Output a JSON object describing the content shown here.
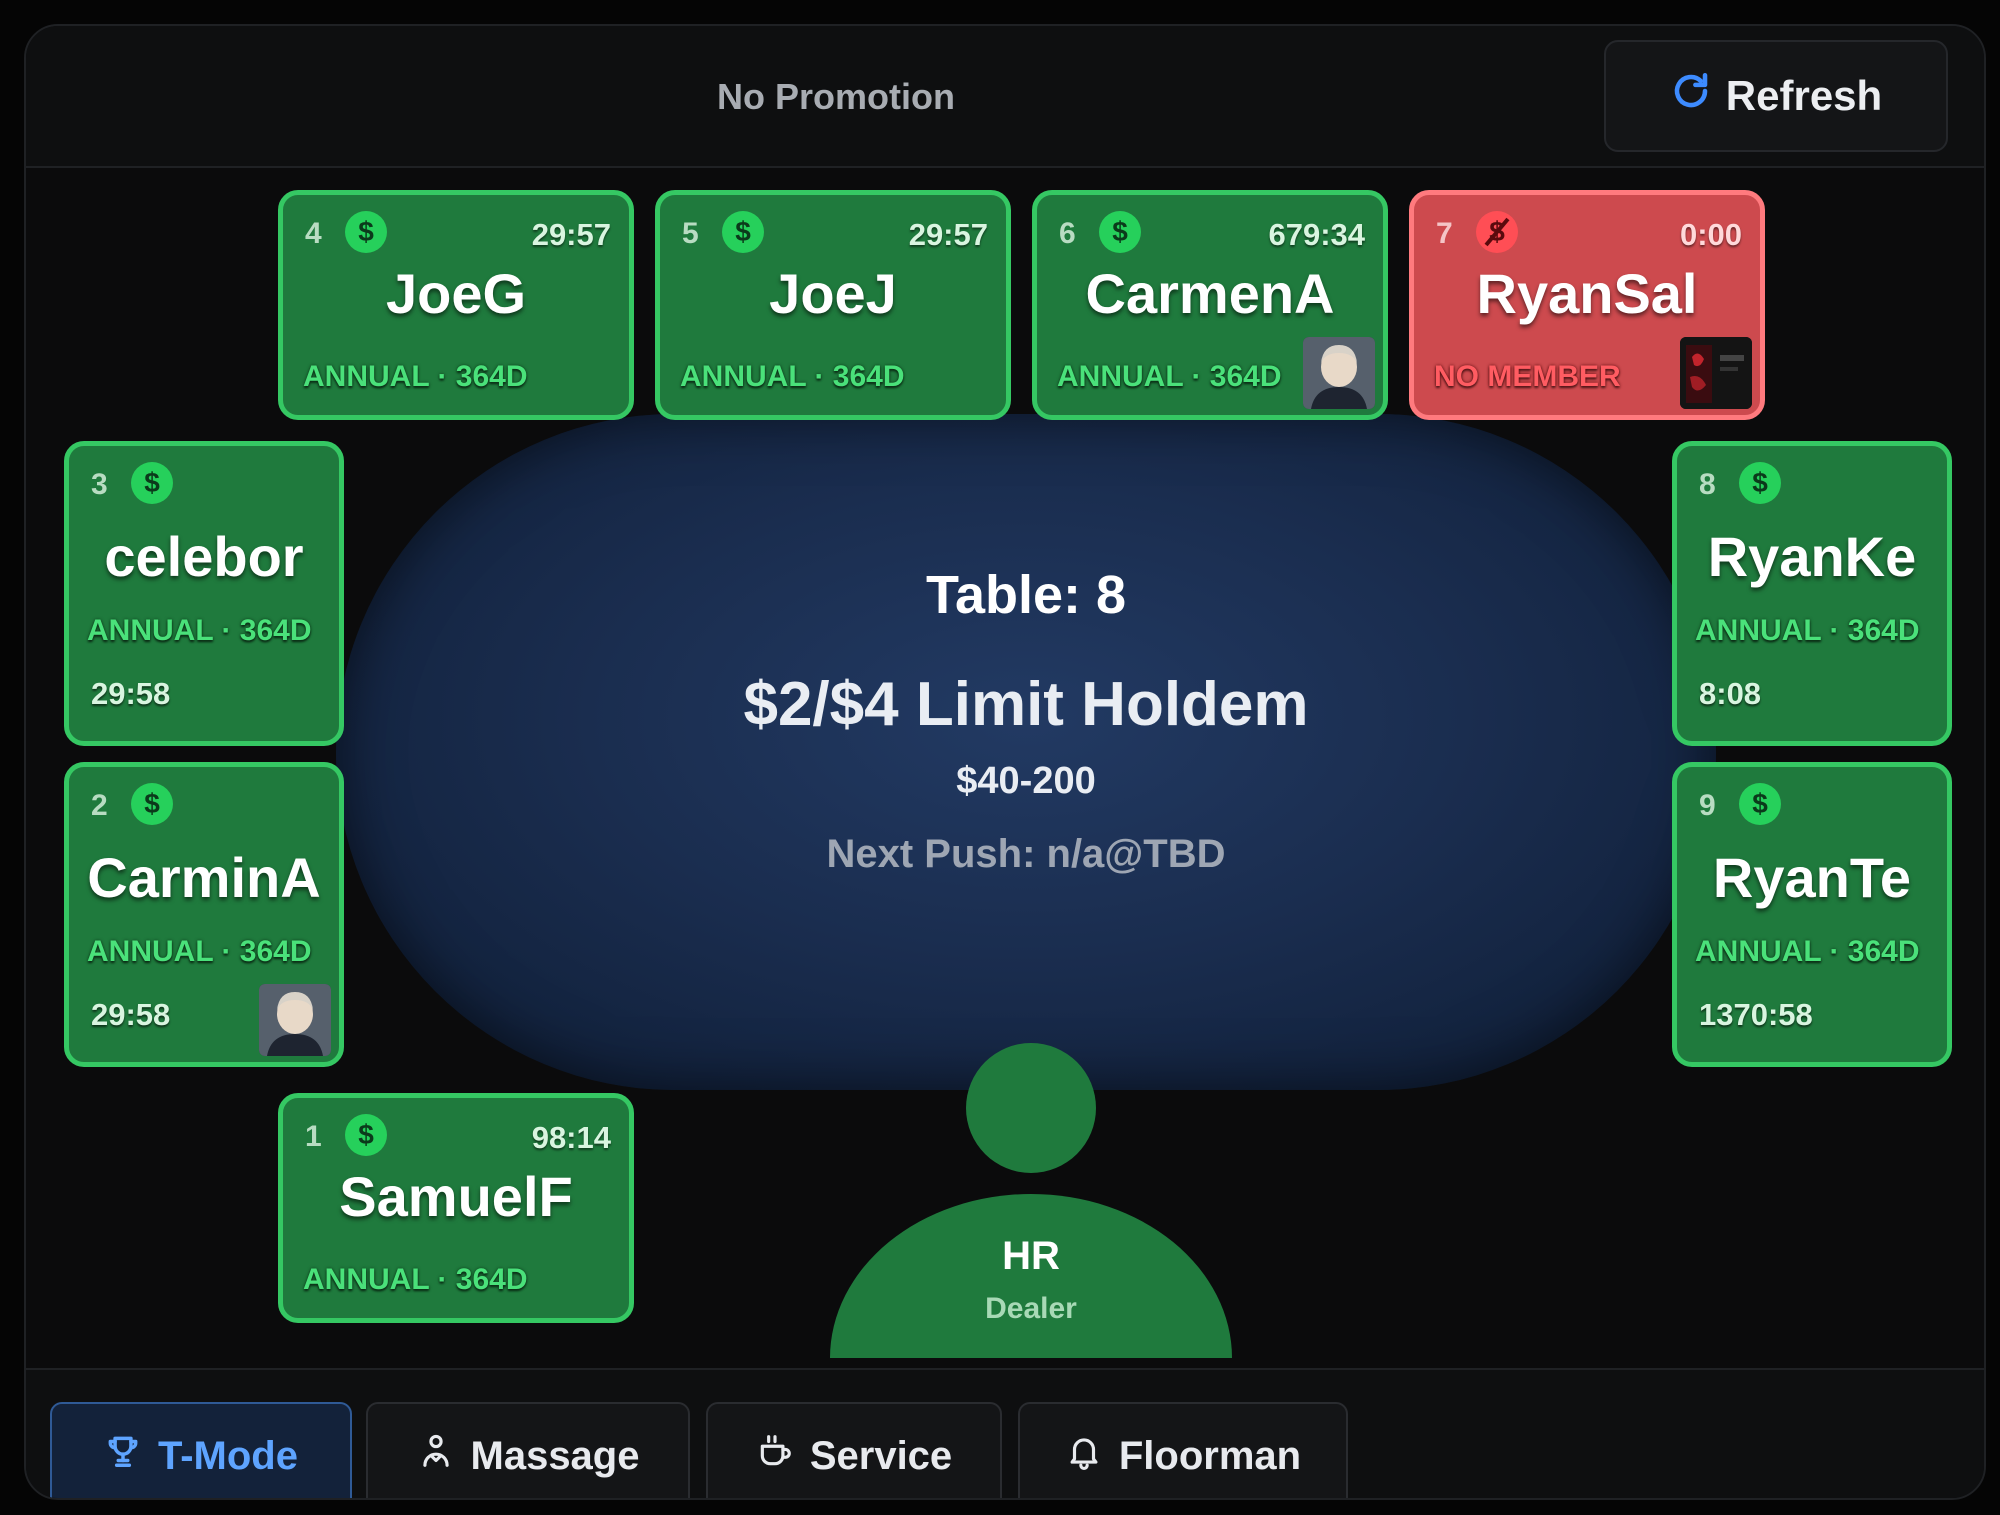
{
  "header": {
    "promotion": "No Promotion",
    "refresh_label": "Refresh"
  },
  "table": {
    "title": "Table: 8",
    "game": "$2/$4 Limit Holdem",
    "buyin": "$40-200",
    "next_push": "Next Push: n/a@TBD"
  },
  "seats": {
    "s1": {
      "num": "1",
      "name": "SamuelF",
      "membership": "ANNUAL · 364D",
      "time": "98:14",
      "paid": true
    },
    "s2": {
      "num": "2",
      "name": "CarminA",
      "membership": "ANNUAL · 364D",
      "time": "29:58",
      "paid": true,
      "avatar": "photo"
    },
    "s3": {
      "num": "3",
      "name": "celebor",
      "membership": "ANNUAL · 364D",
      "time": "29:58",
      "paid": true
    },
    "s4": {
      "num": "4",
      "name": "JoeG",
      "membership": "ANNUAL · 364D",
      "time": "29:57",
      "paid": true
    },
    "s5": {
      "num": "5",
      "name": "JoeJ",
      "membership": "ANNUAL · 364D",
      "time": "29:57",
      "paid": true
    },
    "s6": {
      "num": "6",
      "name": "CarmenA",
      "membership": "ANNUAL · 364D",
      "time": "679:34",
      "paid": true,
      "avatar": "photo"
    },
    "s7": {
      "num": "7",
      "name": "RyanSal",
      "membership": "NO MEMBER",
      "time": "0:00",
      "paid": false,
      "avatar": "photo"
    },
    "s8": {
      "num": "8",
      "name": "RyanKe",
      "membership": "ANNUAL · 364D",
      "time": "8:08",
      "paid": true
    },
    "s9": {
      "num": "9",
      "name": "RyanTe",
      "membership": "ANNUAL · 364D",
      "time": "1370:58",
      "paid": true
    }
  },
  "dealer": {
    "initials": "HR",
    "role": "Dealer"
  },
  "footer": {
    "buttons": [
      {
        "label": "T-Mode",
        "icon": "trophy-icon",
        "active": true
      },
      {
        "label": "Massage",
        "icon": "person-icon",
        "active": false
      },
      {
        "label": "Service",
        "icon": "cup-icon",
        "active": false
      },
      {
        "label": "Floorman",
        "icon": "bell-icon",
        "active": false
      }
    ]
  },
  "colors": {
    "seat_green": "#1f7a3d",
    "seat_green_border": "#35c863",
    "seat_red": "#cd4a4e",
    "accent_blue": "#5ea4ff",
    "felt": "#1a2d4f"
  }
}
